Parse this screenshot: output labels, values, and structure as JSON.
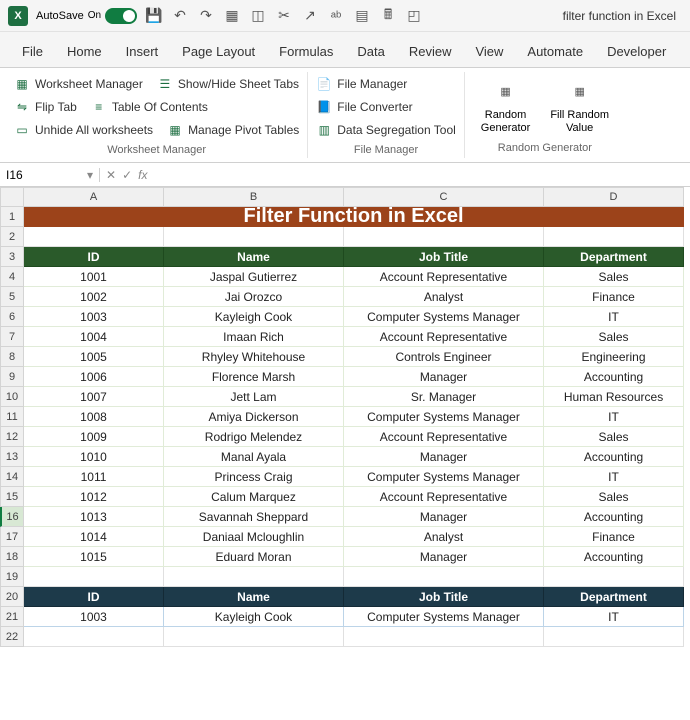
{
  "titlebar": {
    "app_short": "X",
    "autosave_label": "AutoSave",
    "autosave_state": "On",
    "document_title": "filter function in Excel"
  },
  "tabs": [
    "File",
    "Home",
    "Insert",
    "Page Layout",
    "Formulas",
    "Data",
    "Review",
    "View",
    "Automate",
    "Developer"
  ],
  "ribbon": {
    "worksheet_manager": {
      "label": "Worksheet Manager",
      "cmds": {
        "wm": "Worksheet Manager",
        "flip": "Flip Tab",
        "unhide": "Unhide All worksheets",
        "showhide": "Show/Hide Sheet Tabs",
        "toc": "Table Of Contents",
        "pivot": "Manage Pivot Tables"
      }
    },
    "file_manager": {
      "label": "File Manager",
      "cmds": {
        "fm": "File Manager",
        "fc": "File Converter",
        "ds": "Data Segregation Tool"
      }
    },
    "random_generator": {
      "label": "Random Generator",
      "cmds": {
        "rg": "Random\nGenerator",
        "frv": "Fill Random\nValue"
      }
    }
  },
  "formula_bar": {
    "name_box": "I16",
    "fx": "fx"
  },
  "columns": [
    "A",
    "B",
    "C",
    "D"
  ],
  "row_numbers": [
    "1",
    "2",
    "3",
    "4",
    "5",
    "6",
    "7",
    "8",
    "9",
    "10",
    "11",
    "12",
    "13",
    "14",
    "15",
    "16",
    "17",
    "18",
    "19",
    "20",
    "21",
    "22"
  ],
  "selected_row": "16",
  "banner": "Filter Function in Excel",
  "table_headers": [
    "ID",
    "Name",
    "Job Title",
    "Department"
  ],
  "table_rows": [
    [
      "1001",
      "Jaspal Gutierrez",
      "Account Representative",
      "Sales"
    ],
    [
      "1002",
      "Jai Orozco",
      "Analyst",
      "Finance"
    ],
    [
      "1003",
      "Kayleigh Cook",
      "Computer Systems Manager",
      "IT"
    ],
    [
      "1004",
      "Imaan Rich",
      "Account Representative",
      "Sales"
    ],
    [
      "1005",
      "Rhyley Whitehouse",
      "Controls Engineer",
      "Engineering"
    ],
    [
      "1006",
      "Florence Marsh",
      "Manager",
      "Accounting"
    ],
    [
      "1007",
      "Jett Lam",
      "Sr. Manager",
      "Human Resources"
    ],
    [
      "1008",
      "Amiya Dickerson",
      "Computer Systems Manager",
      "IT"
    ],
    [
      "1009",
      "Rodrigo Melendez",
      "Account Representative",
      "Sales"
    ],
    [
      "1010",
      "Manal Ayala",
      "Manager",
      "Accounting"
    ],
    [
      "1011",
      "Princess Craig",
      "Computer Systems Manager",
      "IT"
    ],
    [
      "1012",
      "Calum Marquez",
      "Account Representative",
      "Sales"
    ],
    [
      "1013",
      "Savannah Sheppard",
      "Manager",
      "Accounting"
    ],
    [
      "1014",
      "Daniaal Mcloughlin",
      "Analyst",
      "Finance"
    ],
    [
      "1015",
      "Eduard Moran",
      "Manager",
      "Accounting"
    ]
  ],
  "filter_headers": [
    "ID",
    "Name",
    "Job Title",
    "Department"
  ],
  "filter_row": [
    "1003",
    "Kayleigh Cook",
    "Computer Systems Manager",
    "IT"
  ]
}
